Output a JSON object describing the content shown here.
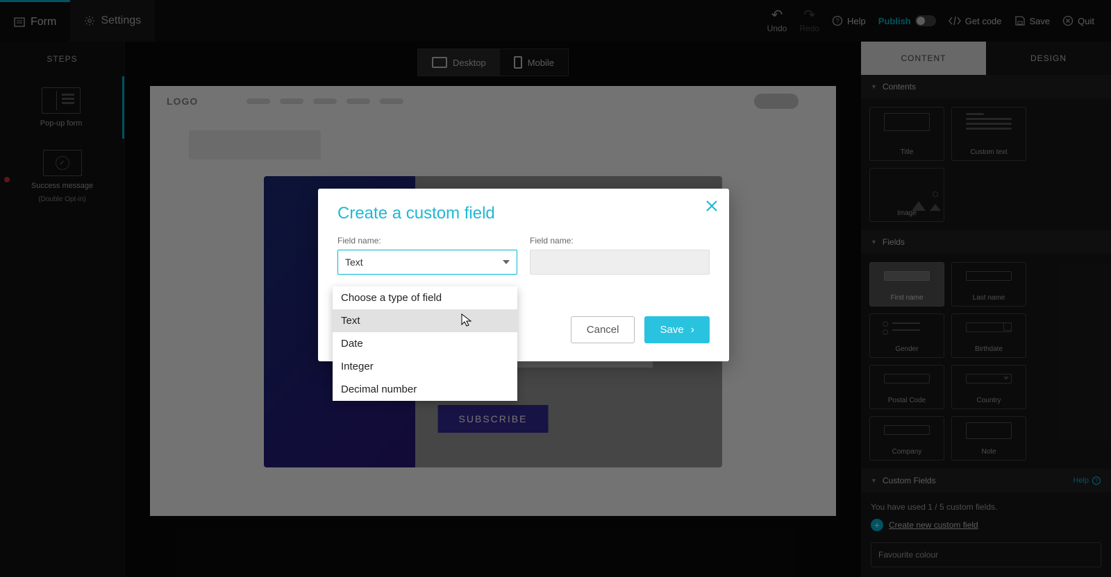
{
  "topbar": {
    "tabs": {
      "form": "Form",
      "settings": "Settings"
    },
    "undo": "Undo",
    "redo": "Redo",
    "help": "Help",
    "publish": "Publish",
    "getcode": "Get code",
    "save": "Save",
    "quit": "Quit"
  },
  "steps": {
    "title": "STEPS",
    "items": [
      {
        "label": "Pop-up form"
      },
      {
        "label": "Success message",
        "sub": "(Double Opt-in)"
      }
    ]
  },
  "device": {
    "desktop": "Desktop",
    "mobile": "Mobile"
  },
  "preview": {
    "logo": "LOGO",
    "subscribe": "SUBSCRIBE"
  },
  "rpanel": {
    "tabs": {
      "content": "CONTENT",
      "design": "DESIGN"
    },
    "sections": {
      "contents": "Contents",
      "fields": "Fields",
      "custom": "Custom Fields",
      "help": "Help"
    },
    "content_cards": [
      "Title",
      "Custom text",
      "Image"
    ],
    "field_cards": [
      "First name",
      "Last name",
      "Gender",
      "Birthdate",
      "Postal Code",
      "Country",
      "Company",
      "Note"
    ],
    "custom_msg": "You have used 1 / 5 custom fields.",
    "create_link": "Create new custom field",
    "custom_items": [
      "Favourite colour"
    ]
  },
  "modal": {
    "title": "Create a custom field",
    "label_type": "Field name:",
    "label_name": "Field name:",
    "selected": "Text",
    "cancel": "Cancel",
    "save": "Save",
    "options": [
      "Choose a type of field",
      "Text",
      "Date",
      "Integer",
      "Decimal number"
    ]
  }
}
